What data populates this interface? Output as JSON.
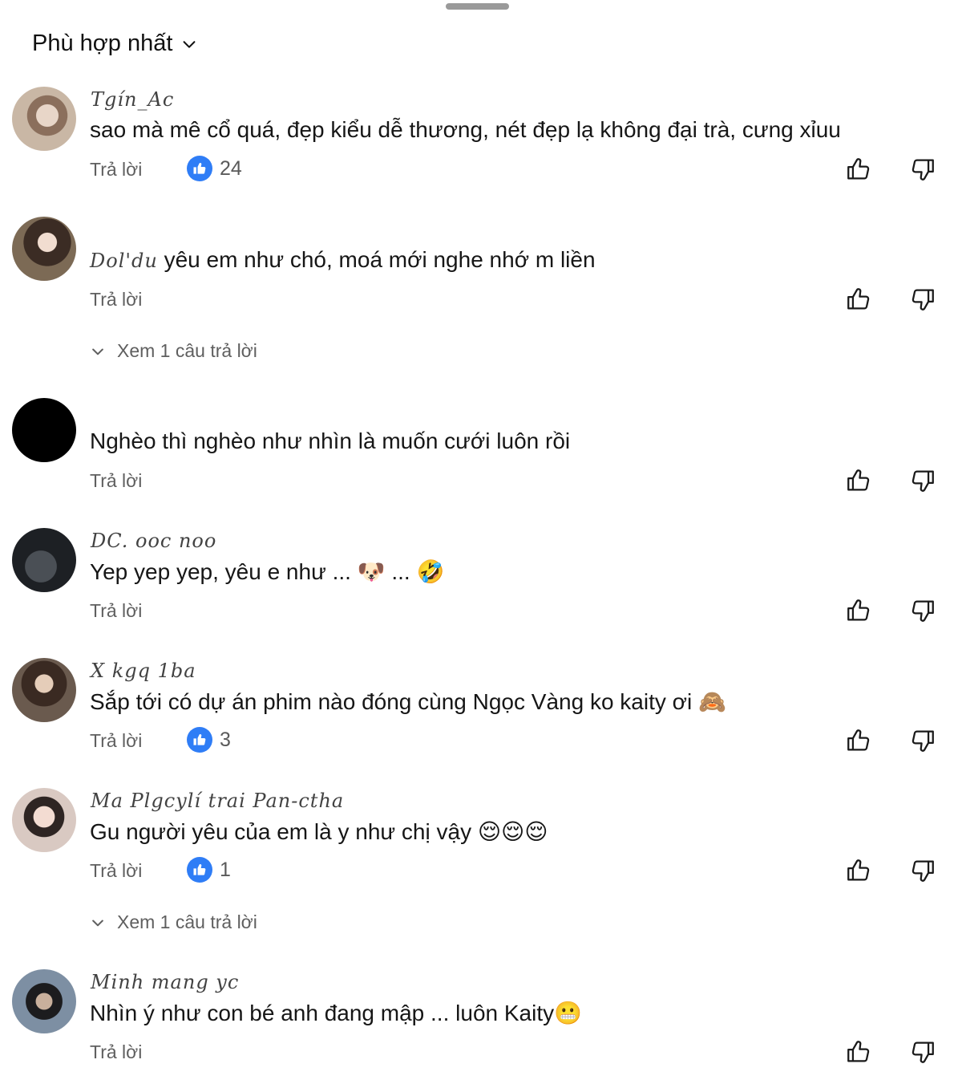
{
  "sort": {
    "label": "Phù hợp nhất"
  },
  "reply_label": "Trả lời",
  "view_replies_label": "Xem 1 câu trả lời",
  "comments": [
    {
      "username": "Tgín_Ac",
      "text": "sao mà mê cổ quá, đẹp kiểu dễ thương, nét đẹp lạ không đại trà, cưng xỉuu",
      "likes": "24"
    },
    {
      "username": "Dol'du",
      "text": "yêu em như chó, moá mới nghe nhớ m liền",
      "likes": ""
    },
    {
      "username": "",
      "text": "Nghèo thì nghèo như nhìn là muốn cưới luôn rồi",
      "likes": ""
    },
    {
      "username": "DC. ooc   noo",
      "text": "Yep yep yep, yêu e như ... 🐶 ... 🤣",
      "likes": ""
    },
    {
      "username": "X  kgq   1ba",
      "text": "Sắp tới có dự án phim nào đóng cùng Ngọc Vàng ko kaity ơi 🙈",
      "likes": "3"
    },
    {
      "username": "Ma Plgcylí trai Pan-ctha",
      "text": "Gu người yêu của em là y như chị vậy 😌😌😌",
      "likes": "1"
    },
    {
      "username": "Minh mang   yc",
      "text": "Nhìn ý như con bé anh đang mập ... luôn Kaity😬",
      "likes": ""
    }
  ],
  "colors": {
    "like_badge": "#2f7df6",
    "secondary_text": "#5f5f5f",
    "handle": "#9a9a9a"
  },
  "icons": [
    "chevron-down-icon",
    "thumbs-up-icon",
    "thumbs-down-icon"
  ]
}
